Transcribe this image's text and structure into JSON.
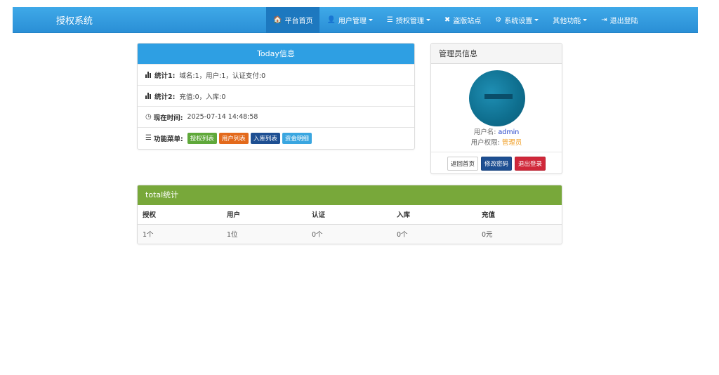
{
  "navbar": {
    "brand": "授权系统",
    "items": [
      {
        "label": "平台首页",
        "icon": "home-icon",
        "glyph": "🏠",
        "active": true,
        "dropdown": false
      },
      {
        "label": "用户管理",
        "icon": "user-icon",
        "glyph": "👤",
        "active": false,
        "dropdown": true
      },
      {
        "label": "授权管理",
        "icon": "list-icon",
        "glyph": "☰",
        "active": false,
        "dropdown": true
      },
      {
        "label": "盗版站点",
        "icon": "close-icon",
        "glyph": "✖",
        "active": false,
        "dropdown": false
      },
      {
        "label": "系统设置",
        "icon": "gear-icon",
        "glyph": "⚙",
        "active": false,
        "dropdown": true
      },
      {
        "label": "其他功能",
        "icon": "",
        "glyph": "",
        "active": false,
        "dropdown": true
      },
      {
        "label": "退出登陆",
        "icon": "logout-icon",
        "glyph": "⇥",
        "active": false,
        "dropdown": false
      }
    ]
  },
  "today": {
    "title": "Today信息",
    "stat1_label": "统计1:",
    "stat1_value": "域名:1，用户:1，认证支付:0",
    "stat2_label": "统计2:",
    "stat2_value": "充值:0，入库:0",
    "time_label": "现在时间:",
    "time_value": "2025-07-14 14:48:58",
    "menu_label": "功能菜单:",
    "menu_items": [
      {
        "label": "授权列表",
        "color": "#5fa83a"
      },
      {
        "label": "用户列表",
        "color": "#e36a1c"
      },
      {
        "label": "入库列表",
        "color": "#1e4f92"
      },
      {
        "label": "资金明细",
        "color": "#3aa6e0"
      }
    ]
  },
  "admin": {
    "title": "管理员信息",
    "username_label": "用户名:",
    "username": "admin",
    "role_label": "用户权限:",
    "role": "管理员",
    "buttons": {
      "home": "返回首页",
      "change_password": "修改密码",
      "logout": "退出登录"
    }
  },
  "total": {
    "title": "total统计",
    "headers": [
      "授权",
      "用户",
      "认证",
      "入库",
      "充值"
    ],
    "values": [
      "1个",
      "1位",
      "0个",
      "0个",
      "0元"
    ]
  },
  "colors": {
    "nav": "#2e9fe3",
    "today_header": "#2e9fe3",
    "total_header": "#78a83a"
  }
}
